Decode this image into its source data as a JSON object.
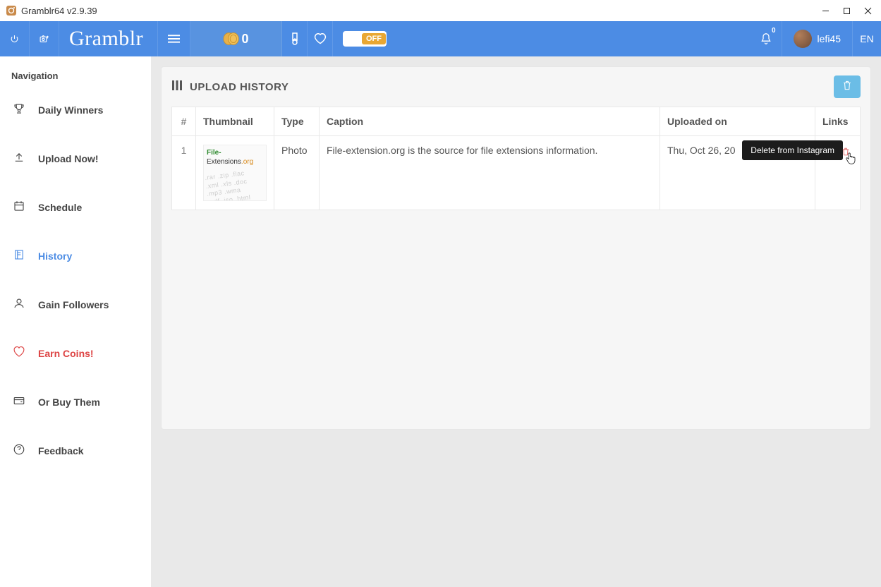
{
  "window": {
    "title": "Gramblr64 v2.9.39"
  },
  "topbar": {
    "brand": "Gramblr",
    "coins": "0",
    "toggle": "OFF",
    "notif_count": "0",
    "username": "lefi45",
    "lang": "EN"
  },
  "sidebar": {
    "heading": "Navigation",
    "items": {
      "daily": "Daily Winners",
      "upload": "Upload Now!",
      "schedule": "Schedule",
      "history": "History",
      "gain": "Gain Followers",
      "earn": "Earn Coins!",
      "buy": "Or Buy Them",
      "feedback": "Feedback"
    }
  },
  "page": {
    "title": "UPLOAD HISTORY",
    "columns": {
      "num": "#",
      "thumb": "Thumbnail",
      "type": "Type",
      "caption": "Caption",
      "uploaded": "Uploaded on",
      "links": "Links"
    },
    "rows": [
      {
        "num": "1",
        "type": "Photo",
        "caption": "File-extension.org is the source for file extensions information.",
        "uploaded": "Thu, Oct 26, 20"
      }
    ],
    "tooltip": "Delete from Instagram"
  },
  "thumb": {
    "brand_a": "File-",
    "brand_b": "Extensions",
    "brand_c": ".org"
  }
}
